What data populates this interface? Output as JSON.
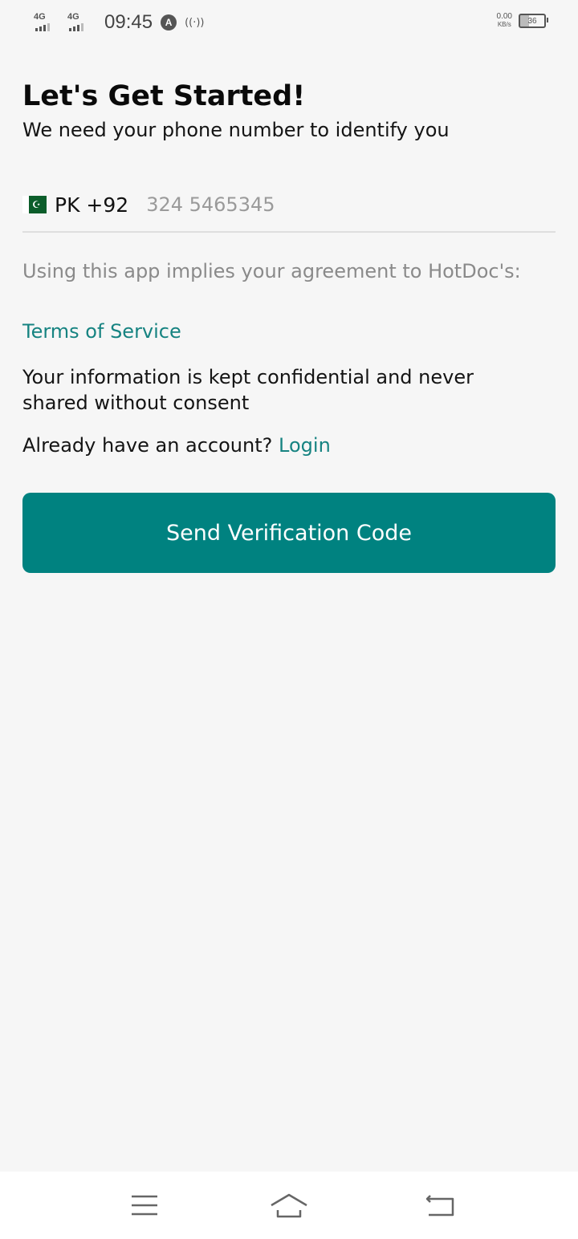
{
  "status_bar": {
    "network1": "4G",
    "network2": "4G",
    "time": "09:45",
    "nav_app_letter": "A",
    "hotspot_icon": "hotspot-icon",
    "speed_value": "0.00",
    "speed_unit": "KB/s",
    "battery": "36"
  },
  "header": {
    "title": "Let's Get Started!",
    "subtitle": "We need your phone number to identify you"
  },
  "phone": {
    "flag": "pakistan-flag",
    "country_code": "PK +92",
    "placeholder": "324 5465345",
    "value": ""
  },
  "agreement": {
    "text": "Using this app implies your agreement to HotDoc's:",
    "terms_link": "Terms of Service"
  },
  "confidential_text": "Your information is kept confidential and never shared without consent",
  "account": {
    "prompt": "Already have an account?",
    "login_link": "Login"
  },
  "send_button": "Send Verification Code",
  "colors": {
    "accent": "#008280",
    "link": "#168381",
    "background": "#f6f6f6"
  },
  "nav": {
    "menu_icon": "menu-icon",
    "home_icon": "home-icon",
    "back_icon": "back-icon"
  }
}
